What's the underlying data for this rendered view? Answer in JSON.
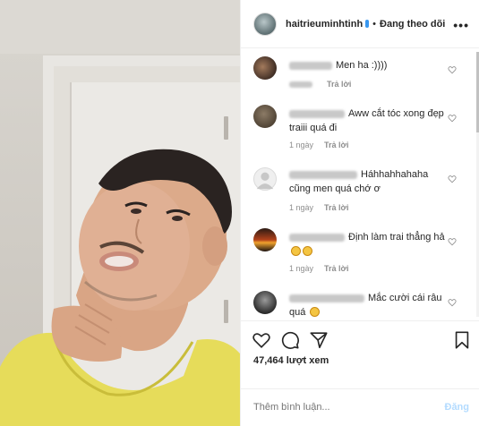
{
  "header": {
    "username": "haitrieuminhtinh",
    "separator": "•",
    "follow_label": "Đang theo dõi",
    "more_icon": "more-horizontal-icon"
  },
  "comments": [
    {
      "text": "Men ha :))))",
      "time": "",
      "reply": "Trả lời",
      "emojis": 0
    },
    {
      "text": "Aww cắt tóc xong đẹp traiii quá đi",
      "time": "1 ngày",
      "reply": "Trả lời",
      "emojis": 0
    },
    {
      "text": "Háhhahhahaha cũng men quá chớ ơ",
      "time": "1 ngày",
      "reply": "Trả lời",
      "emojis": 0
    },
    {
      "text": "Định làm trai thẳng hả",
      "time": "1 ngày",
      "reply": "Trả lời",
      "emojis": 2
    },
    {
      "text": "Mắc cười cái râu quá",
      "time": "1 ngày",
      "reply": "Trả lời",
      "emojis": 1
    }
  ],
  "actions": {
    "like_icon": "heart-icon",
    "comment_icon": "comment-icon",
    "share_icon": "send-icon",
    "save_icon": "bookmark-icon",
    "views": "47,464 lượt xem"
  },
  "add_comment": {
    "placeholder": "Thêm bình luận...",
    "post_label": "Đăng"
  },
  "colors": {
    "text": "#262626",
    "muted": "#8e8e8e",
    "post_disabled": "#b3dbff",
    "verified": "#3897f0"
  }
}
